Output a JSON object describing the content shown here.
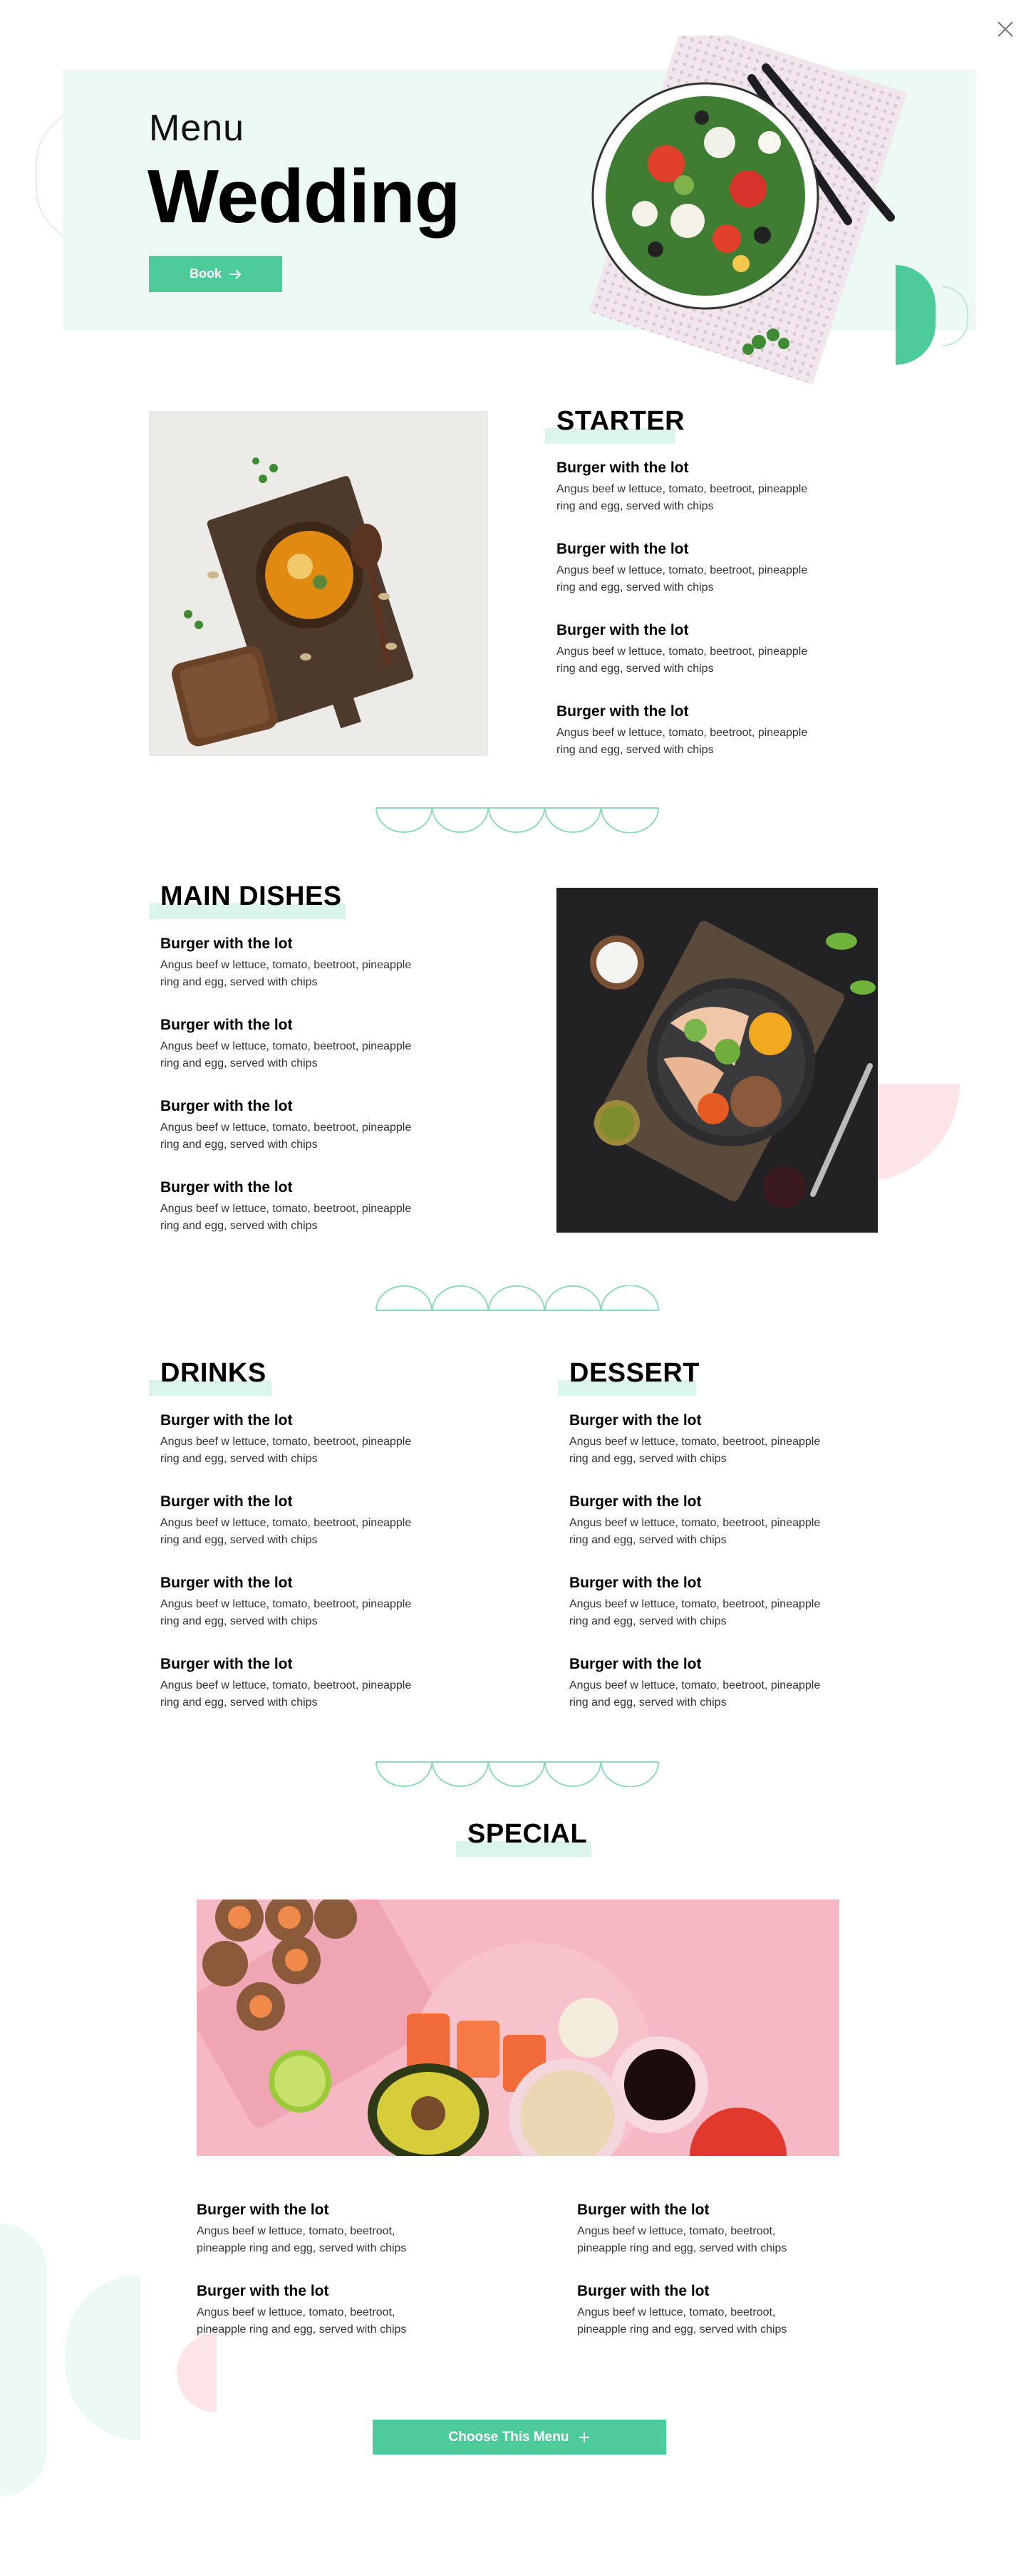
{
  "hero": {
    "subtitle": "Menu",
    "title": "Wedding",
    "book_label": "Book",
    "book_icon": "arrow-right-icon"
  },
  "close_icon": "close-icon",
  "colors": {
    "accent": "#4ecb9a",
    "hero_bg": "#ecf9f4",
    "title_highlight": "#dcf5ea",
    "pink_decor": "#fde4e7"
  },
  "starter": {
    "title": "STARTER",
    "items": [
      {
        "name": "Burger with the lot",
        "desc_1": "Angus beef w lettuce, tomato, beetroot, pineapple",
        "desc_2": "ring and egg, served with chips"
      },
      {
        "name": "Burger with the lot",
        "desc_1": "Angus beef w lettuce, tomato, beetroot, pineapple",
        "desc_2": "ring and egg, served with chips"
      },
      {
        "name": "Burger with the lot",
        "desc_1": "Angus beef w lettuce, tomato, beetroot, pineapple",
        "desc_2": "ring and egg, served with chips"
      },
      {
        "name": "Burger with the lot",
        "desc_1": "Angus beef w lettuce, tomato, beetroot, pineapple",
        "desc_2": "ring and egg, served with chips"
      }
    ]
  },
  "main_dishes": {
    "title": "MAIN DISHES",
    "items": [
      {
        "name": "Burger with the lot",
        "desc_1": "Angus beef w lettuce, tomato, beetroot, pineapple",
        "desc_2": "ring and egg, served with chips"
      },
      {
        "name": "Burger with the lot",
        "desc_1": "Angus beef w lettuce, tomato, beetroot, pineapple",
        "desc_2": "ring and egg, served with chips"
      },
      {
        "name": "Burger with the lot",
        "desc_1": "Angus beef w lettuce, tomato, beetroot, pineapple",
        "desc_2": "ring and egg, served with chips"
      },
      {
        "name": "Burger with the lot",
        "desc_1": "Angus beef w lettuce, tomato, beetroot, pineapple",
        "desc_2": "ring and egg, served with chips"
      }
    ]
  },
  "drinks": {
    "title": "DRINKS",
    "items": [
      {
        "name": "Burger with the lot",
        "desc_1": "Angus beef w lettuce, tomato, beetroot, pineapple",
        "desc_2": "ring and egg, served with chips"
      },
      {
        "name": "Burger with the lot",
        "desc_1": "Angus beef w lettuce, tomato, beetroot, pineapple",
        "desc_2": "ring and egg, served with chips"
      },
      {
        "name": "Burger with the lot",
        "desc_1": "Angus beef w lettuce, tomato, beetroot, pineapple",
        "desc_2": "ring and egg, served with chips"
      },
      {
        "name": "Burger with the lot",
        "desc_1": "Angus beef w lettuce, tomato, beetroot, pineapple",
        "desc_2": "ring and egg, served with chips"
      }
    ]
  },
  "dessert": {
    "title": "DESSERT",
    "items": [
      {
        "name": "Burger with the lot",
        "desc_1": "Angus beef w lettuce, tomato, beetroot, pineapple",
        "desc_2": "ring and egg, served with chips"
      },
      {
        "name": "Burger with the lot",
        "desc_1": "Angus beef w lettuce, tomato, beetroot, pineapple",
        "desc_2": "ring and egg, served with chips"
      },
      {
        "name": "Burger with the lot",
        "desc_1": "Angus beef w lettuce, tomato, beetroot, pineapple",
        "desc_2": "ring and egg, served with chips"
      },
      {
        "name": "Burger with the lot",
        "desc_1": "Angus beef w lettuce, tomato, beetroot, pineapple",
        "desc_2": "ring and egg, served with chips"
      }
    ]
  },
  "special": {
    "title": "SPECIAL",
    "items": [
      {
        "name": "Burger with the lot",
        "desc_1": "Angus beef w lettuce, tomato, beetroot,",
        "desc_2": "pineapple ring and egg, served with chips"
      },
      {
        "name": "Burger with the lot",
        "desc_1": "Angus beef w lettuce, tomato, beetroot,",
        "desc_2": "pineapple ring and egg, served with chips"
      },
      {
        "name": "Burger with the lot",
        "desc_1": "Angus beef w lettuce, tomato, beetroot,",
        "desc_2": "pineapple ring and egg, served with chips"
      },
      {
        "name": "Burger with the lot",
        "desc_1": "Angus beef w lettuce, tomato, beetroot,",
        "desc_2": "pineapple ring and egg, served with chips"
      }
    ]
  },
  "cta": {
    "label": "Choose This Menu",
    "icon": "plus-icon"
  }
}
